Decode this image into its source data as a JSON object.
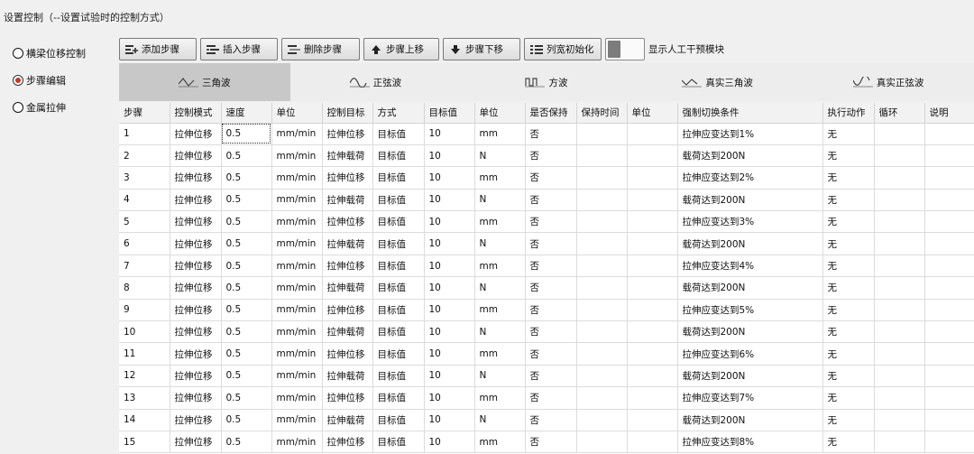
{
  "panel": {
    "title": "设置控制（--设置试验时的控制方式）"
  },
  "modes": [
    {
      "label": "横梁位移控制",
      "selected": false
    },
    {
      "label": "步骤编辑",
      "selected": true
    },
    {
      "label": "金属拉伸",
      "selected": false
    }
  ],
  "toolbar": {
    "add": "添加步骤",
    "insert": "插入步骤",
    "delete": "删除步骤",
    "up": "步骤上移",
    "down": "步骤下移",
    "reset_width": "列宽初始化",
    "toggle_label": "显示人工干预模块",
    "toggle_on": false
  },
  "waves": [
    {
      "label": "三角波",
      "icon": "triangle-wave-icon",
      "active": true
    },
    {
      "label": "正弦波",
      "icon": "sine-wave-icon",
      "active": false
    },
    {
      "label": "方波",
      "icon": "square-wave-icon",
      "active": false
    },
    {
      "label": "真实三角波",
      "icon": "real-triangle-wave-icon",
      "active": false
    },
    {
      "label": "真实正弦波",
      "icon": "real-sine-wave-icon",
      "active": false
    }
  ],
  "table": {
    "columns": [
      "步骤",
      "控制模式",
      "速度",
      "单位",
      "控制目标",
      "方式",
      "目标值",
      "单位",
      "是否保持",
      "保持时间",
      "单位",
      "强制切换条件",
      "执行动作",
      "循环",
      "说明"
    ],
    "rows": [
      [
        "1",
        "拉伸位移",
        "0.5",
        "mm/min",
        "拉伸位移",
        "目标值",
        "10",
        "mm",
        "否",
        "",
        "",
        "拉伸应变达到1%",
        "无",
        "",
        ""
      ],
      [
        "2",
        "拉伸位移",
        "0.5",
        "mm/min",
        "拉伸载荷",
        "目标值",
        "10",
        "N",
        "否",
        "",
        "",
        "载荷达到200N",
        "无",
        "",
        ""
      ],
      [
        "3",
        "拉伸位移",
        "0.5",
        "mm/min",
        "拉伸位移",
        "目标值",
        "10",
        "mm",
        "否",
        "",
        "",
        "拉伸应变达到2%",
        "无",
        "",
        ""
      ],
      [
        "4",
        "拉伸位移",
        "0.5",
        "mm/min",
        "拉伸载荷",
        "目标值",
        "10",
        "N",
        "否",
        "",
        "",
        "载荷达到200N",
        "无",
        "",
        ""
      ],
      [
        "5",
        "拉伸位移",
        "0.5",
        "mm/min",
        "拉伸位移",
        "目标值",
        "10",
        "mm",
        "否",
        "",
        "",
        "拉伸应变达到3%",
        "无",
        "",
        ""
      ],
      [
        "6",
        "拉伸位移",
        "0.5",
        "mm/min",
        "拉伸载荷",
        "目标值",
        "10",
        "N",
        "否",
        "",
        "",
        "载荷达到200N",
        "无",
        "",
        ""
      ],
      [
        "7",
        "拉伸位移",
        "0.5",
        "mm/min",
        "拉伸位移",
        "目标值",
        "10",
        "mm",
        "否",
        "",
        "",
        "拉伸应变达到4%",
        "无",
        "",
        ""
      ],
      [
        "8",
        "拉伸位移",
        "0.5",
        "mm/min",
        "拉伸载荷",
        "目标值",
        "10",
        "N",
        "否",
        "",
        "",
        "载荷达到200N",
        "无",
        "",
        ""
      ],
      [
        "9",
        "拉伸位移",
        "0.5",
        "mm/min",
        "拉伸位移",
        "目标值",
        "10",
        "mm",
        "否",
        "",
        "",
        "拉伸应变达到5%",
        "无",
        "",
        ""
      ],
      [
        "10",
        "拉伸位移",
        "0.5",
        "mm/min",
        "拉伸载荷",
        "目标值",
        "10",
        "N",
        "否",
        "",
        "",
        "载荷达到200N",
        "无",
        "",
        ""
      ],
      [
        "11",
        "拉伸位移",
        "0.5",
        "mm/min",
        "拉伸位移",
        "目标值",
        "10",
        "mm",
        "否",
        "",
        "",
        "拉伸应变达到6%",
        "无",
        "",
        ""
      ],
      [
        "12",
        "拉伸位移",
        "0.5",
        "mm/min",
        "拉伸载荷",
        "目标值",
        "10",
        "N",
        "否",
        "",
        "",
        "载荷达到200N",
        "无",
        "",
        ""
      ],
      [
        "13",
        "拉伸位移",
        "0.5",
        "mm/min",
        "拉伸位移",
        "目标值",
        "10",
        "mm",
        "否",
        "",
        "",
        "拉伸应变达到7%",
        "无",
        "",
        ""
      ],
      [
        "14",
        "拉伸位移",
        "0.5",
        "mm/min",
        "拉伸载荷",
        "目标值",
        "10",
        "N",
        "否",
        "",
        "",
        "载荷达到200N",
        "无",
        "",
        ""
      ],
      [
        "15",
        "拉伸位移",
        "0.5",
        "mm/min",
        "拉伸位移",
        "目标值",
        "10",
        "mm",
        "否",
        "",
        "",
        "拉伸应变达到8%",
        "无",
        "",
        ""
      ]
    ]
  },
  "colors": {
    "radio_selected": "#c0392b",
    "active_tab": "#c8c8c8"
  }
}
